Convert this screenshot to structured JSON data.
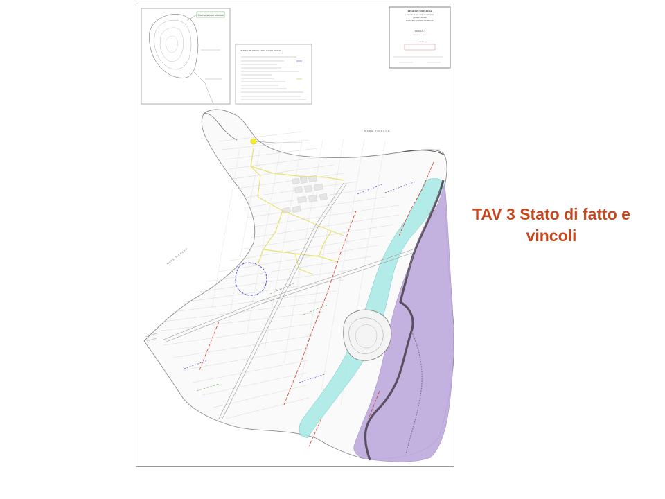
{
  "slide": {
    "title": "TAV 3 Stato di fatto e vincoli"
  },
  "map": {
    "inset_label": "Riserva naturale orientata",
    "legend_title": "LEGENDA DEI VINCOLI E DELLO STATO DI FATTO",
    "cartouche": {
      "region": "REGIONE SICILIANA",
      "comune": "COMUNE DI ISOLA DELLE FEMMINE",
      "provincia": "(Provincia di Palermo)",
      "plan": "PIANO REGOLATORE GENERALE",
      "sheet": "TAVOLA N. 3",
      "subject": "Stato di fatto e vincoli",
      "scale": "scala 1:2.000"
    },
    "sea_labels": [
      "MARE TIRRENO",
      "MARE TIRRENO"
    ],
    "colors": {
      "cyan_zone": "#a6e8e4",
      "violet_zone": "#bca9dc",
      "ridge": "#5a5060",
      "yellow_roads": "#e8e070",
      "blue_perimeter": "#4a50c8",
      "red_lines": "#d83a2a",
      "title": "#c8461c"
    }
  }
}
